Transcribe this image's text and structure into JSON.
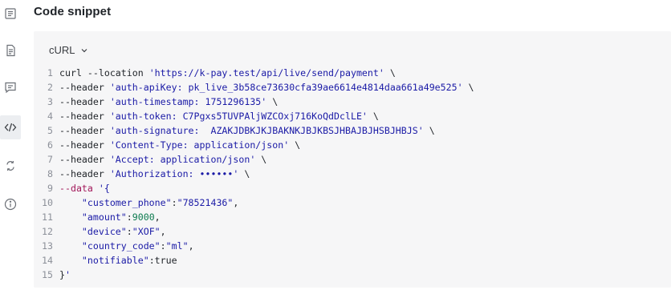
{
  "title": "Code snippet",
  "language": {
    "selected": "cURL"
  },
  "sidebar": {
    "icons": [
      "list-icon",
      "document-icon",
      "message-icon",
      "code-icon",
      "sync-icon",
      "info-icon"
    ],
    "active": "code-icon"
  },
  "code": {
    "lines": [
      {
        "n": "1",
        "parts": [
          [
            "t",
            "curl --location "
          ],
          [
            "s",
            "'https://k-pay.test/api/live/send/payment'"
          ],
          [
            "t",
            " \\"
          ]
        ]
      },
      {
        "n": "2",
        "parts": [
          [
            "t",
            "--header "
          ],
          [
            "s",
            "'auth-apiKey: pk_live_3b58ce73630cfa39ae6614e4814daa661a49e525'"
          ],
          [
            "t",
            " \\"
          ]
        ]
      },
      {
        "n": "3",
        "parts": [
          [
            "t",
            "--header "
          ],
          [
            "s",
            "'auth-timestamp: 1751296135'"
          ],
          [
            "t",
            " \\"
          ]
        ]
      },
      {
        "n": "4",
        "parts": [
          [
            "t",
            "--header "
          ],
          [
            "s",
            "'auth-token: C7Pgxs5TUVPAljWZCOxj716KoQdDclLE'"
          ],
          [
            "t",
            " \\"
          ]
        ]
      },
      {
        "n": "5",
        "parts": [
          [
            "t",
            "--header "
          ],
          [
            "s",
            "'auth-signature:  AZAKJDBKJKJBAKNKJBJKBSJHBAJBJHSBJHBJS'"
          ],
          [
            "t",
            " \\"
          ]
        ]
      },
      {
        "n": "6",
        "parts": [
          [
            "t",
            "--header "
          ],
          [
            "s",
            "'Content-Type: application/json'"
          ],
          [
            "t",
            " \\"
          ]
        ]
      },
      {
        "n": "7",
        "parts": [
          [
            "t",
            "--header "
          ],
          [
            "s",
            "'Accept: application/json'"
          ],
          [
            "t",
            " \\"
          ]
        ]
      },
      {
        "n": "8",
        "parts": [
          [
            "t",
            "--header "
          ],
          [
            "s",
            "'Authorization: ••••••'"
          ],
          [
            "t",
            " \\"
          ]
        ]
      },
      {
        "n": "9",
        "parts": [
          [
            "k",
            "--data "
          ],
          [
            "s",
            "'{"
          ]
        ]
      },
      {
        "n": "10",
        "parts": [
          [
            "t",
            "    "
          ],
          [
            "s",
            "\"customer_phone\""
          ],
          [
            "t",
            ":"
          ],
          [
            "s",
            "\"78521436\""
          ],
          [
            "t",
            ","
          ]
        ]
      },
      {
        "n": "11",
        "parts": [
          [
            "t",
            "    "
          ],
          [
            "s",
            "\"amount\""
          ],
          [
            "t",
            ":"
          ],
          [
            "n",
            "9000"
          ],
          [
            "t",
            ","
          ]
        ]
      },
      {
        "n": "12",
        "parts": [
          [
            "t",
            "    "
          ],
          [
            "s",
            "\"device\""
          ],
          [
            "t",
            ":"
          ],
          [
            "s",
            "\"XOF\""
          ],
          [
            "t",
            ","
          ]
        ]
      },
      {
        "n": "13",
        "parts": [
          [
            "t",
            "    "
          ],
          [
            "s",
            "\"country_code\""
          ],
          [
            "t",
            ":"
          ],
          [
            "s",
            "\"ml\""
          ],
          [
            "t",
            ","
          ]
        ]
      },
      {
        "n": "14",
        "parts": [
          [
            "t",
            "    "
          ],
          [
            "s",
            "\"notifiable\""
          ],
          [
            "t",
            ":true"
          ]
        ]
      },
      {
        "n": "15",
        "parts": [
          [
            "t",
            "}"
          ],
          [
            "s",
            "'"
          ]
        ]
      }
    ]
  }
}
